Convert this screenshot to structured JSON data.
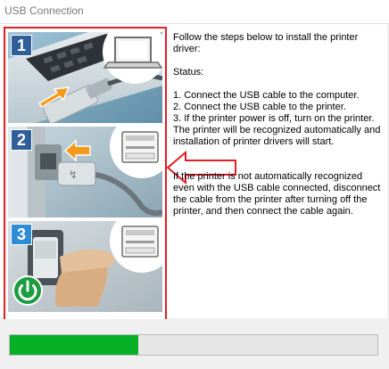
{
  "window": {
    "title": "USB Connection"
  },
  "steps": [
    {
      "number": "1"
    },
    {
      "number": "2"
    },
    {
      "number": "3"
    }
  ],
  "instructions": {
    "intro": "Follow the steps below to install the printer driver:",
    "status_label": "Status:",
    "lines": [
      "1. Connect the USB cable to the computer.",
      "2. Connect the USB cable to the printer.",
      "3. If the printer power is off, turn on the printer.",
      "The printer will be recognized automatically and installation of printer drivers will start."
    ],
    "fallback": "If the printer is not automatically recognized even with the USB cable connected, disconnect the cable from the printer after turning off the printer, and then connect the cable again."
  },
  "progress": {
    "value": 0.35
  },
  "colors": {
    "highlight_border": "#e01e24",
    "progress_fill": "#06b025",
    "step_badge": "#2f5e99",
    "step_badge_active": "#2f8dd6",
    "power_icon": "#1ec04a",
    "arrow_orange": "#f29a1a"
  }
}
